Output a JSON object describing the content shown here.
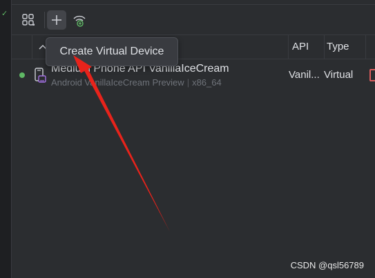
{
  "gutter": {
    "check_icon": "check-icon"
  },
  "toolbar": {
    "layout_icon": "layout-grid-icon",
    "add_icon": "plus-icon",
    "pair_icon": "wireless-pairing-icon"
  },
  "table": {
    "columns": {
      "api": "API",
      "type": "Type"
    },
    "rows": [
      {
        "status_color": "#5fb865",
        "name": "Medium Phone API VanillaIceCream",
        "sub_target": "Android VanillaIceCream Preview",
        "sub_abi": "x86_64",
        "api": "Vanil...",
        "type": "Virtual"
      }
    ]
  },
  "tooltip": {
    "text": "Create Virtual Device"
  },
  "annotation": {
    "arrow_color": "#e8231b"
  },
  "watermark": {
    "text": "CSDN @qsl56789"
  }
}
